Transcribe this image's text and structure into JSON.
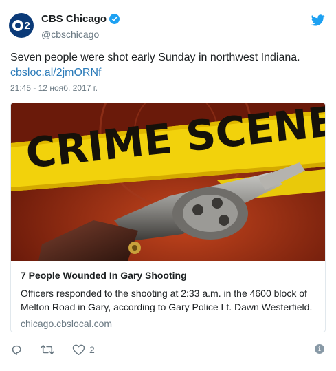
{
  "author": {
    "name": "CBS Chicago",
    "handle": "@cbschicago",
    "avatar_label": "2",
    "verified": true
  },
  "tweet": {
    "text": "Seven people were shot early Sunday in northwest Indiana.",
    "link": "cbsloc.al/2jmORNf",
    "timestamp": "21:45 - 12 нояб. 2017 г."
  },
  "card": {
    "image_text": "CRIME SCENE",
    "title": "7 People Wounded In Gary Shooting",
    "description": "Officers responded to the shooting at 2:33 a.m. in the 4600 block of Melton Road in Gary, according to Gary Police Lt. Dawn Westerfield.",
    "domain": "chicago.cbslocal.com"
  },
  "actions": {
    "reply_icon": "reply-icon",
    "retweet_icon": "retweet-icon",
    "like_icon": "heart-icon",
    "like_count": "2",
    "info_icon": "info-icon"
  },
  "colors": {
    "link": "#2b7bb9",
    "twitter_blue": "#1da1f2",
    "muted": "#697882",
    "tape_yellow": "#f2d20c"
  }
}
